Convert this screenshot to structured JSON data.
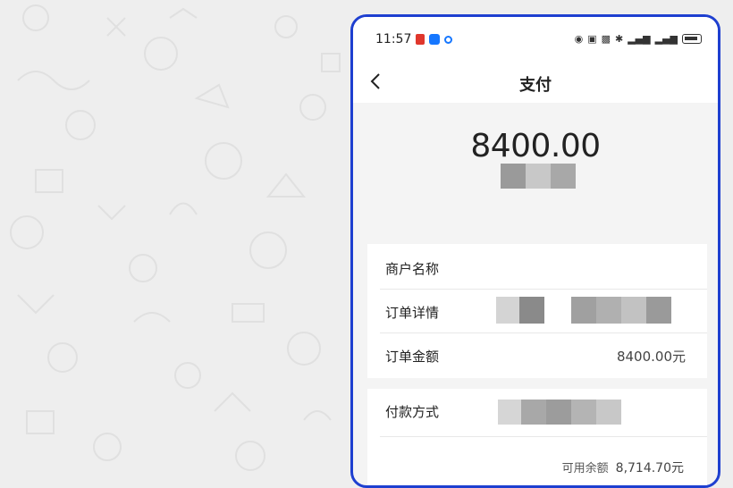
{
  "status_bar": {
    "time": "11:57",
    "icons": [
      "app-notification-icon",
      "blue-square-icon",
      "blue-dot-icon",
      "eye-icon",
      "nfc-icon",
      "vibrate-icon",
      "bluetooth-icon",
      "signal-icon",
      "signal-icon",
      "battery-icon"
    ]
  },
  "header": {
    "title": "支付",
    "back_icon": "chevron-left-icon"
  },
  "payment": {
    "amount": "8400.00"
  },
  "details": {
    "rows": [
      {
        "label": "商户名称",
        "value": ""
      },
      {
        "label": "订单详情",
        "value": ""
      },
      {
        "label": "订单金额",
        "value": "8400.00元"
      }
    ]
  },
  "payment_method": {
    "label": "付款方式",
    "balance_label": "可用余额",
    "balance_value": "8,714.70元"
  },
  "colors": {
    "frame": "#1e3fd0",
    "background": "#f4f4f4",
    "card": "#ffffff"
  }
}
